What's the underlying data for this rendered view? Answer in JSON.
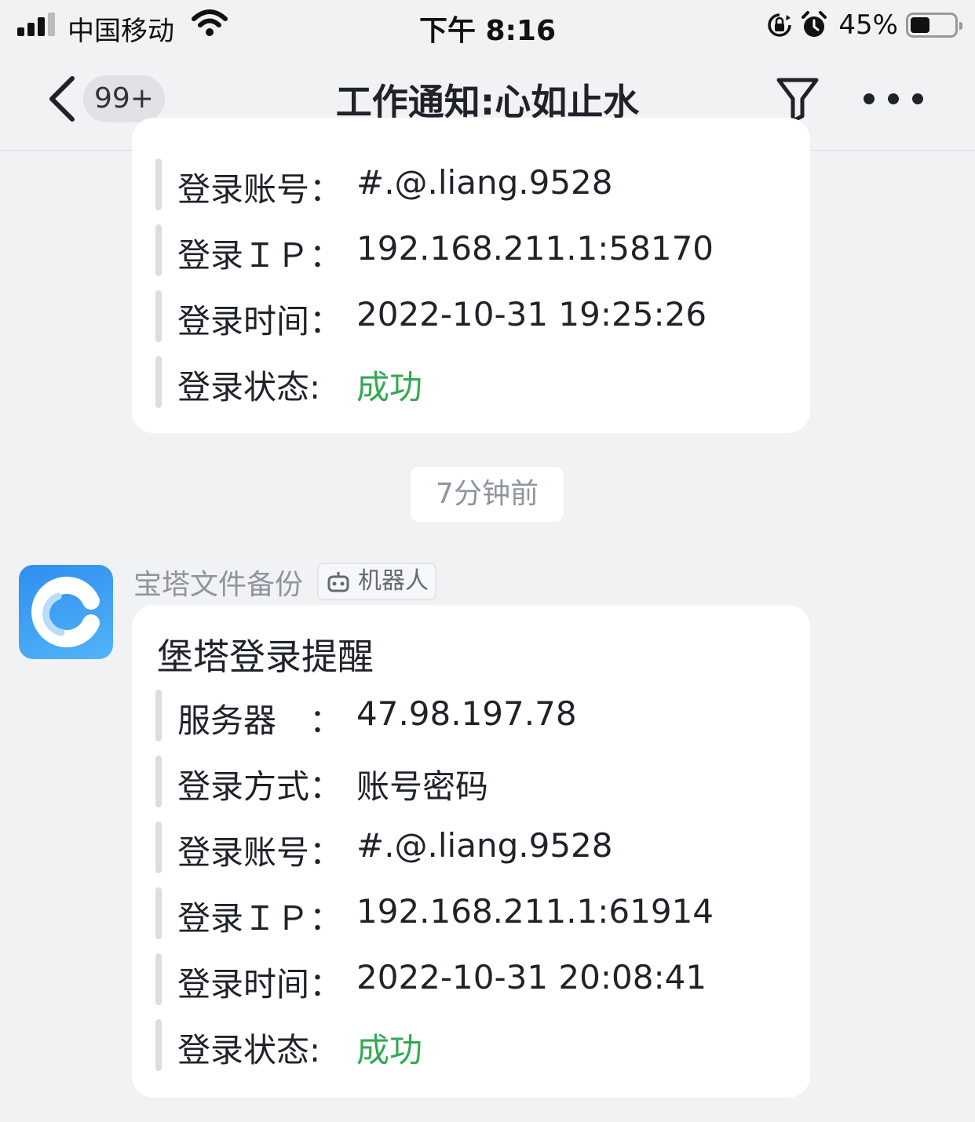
{
  "status_bar": {
    "carrier": "中国移动",
    "time": "下午 8:16",
    "battery": "45%",
    "battery_level": 0.45
  },
  "nav": {
    "unread_badge": "99+",
    "title": "工作通知:心如止水"
  },
  "messages": [
    {
      "rows": [
        {
          "label": "登录账号：",
          "value": "#.@.liang.9528"
        },
        {
          "label": "登录ＩＰ：",
          "value": "192.168.211.1:58170"
        },
        {
          "label": "登录时间：",
          "value": "2022-10-31 19:25:26"
        },
        {
          "label": "登录状态:",
          "value": "成功"
        }
      ]
    },
    {
      "timestamp": "7分钟前",
      "sender": "宝塔文件备份",
      "sender_tag": "机器人",
      "title": "堡塔登录提醒",
      "rows": [
        {
          "label": "服务器　：",
          "value": "47.98.197.78"
        },
        {
          "label": "登录方式：",
          "value": "账号密码"
        },
        {
          "label": "登录账号：",
          "value": "#.@.liang.9528"
        },
        {
          "label": "登录ＩＰ：",
          "value": "192.168.211.1:61914"
        },
        {
          "label": "登录时间：",
          "value": "2022-10-31 20:08:41"
        },
        {
          "label": "登录状态:",
          "value": "成功"
        }
      ]
    }
  ],
  "colors": {
    "success": "#34a853",
    "background": "#f1f2f4",
    "avatar": "#2f8ef0"
  }
}
